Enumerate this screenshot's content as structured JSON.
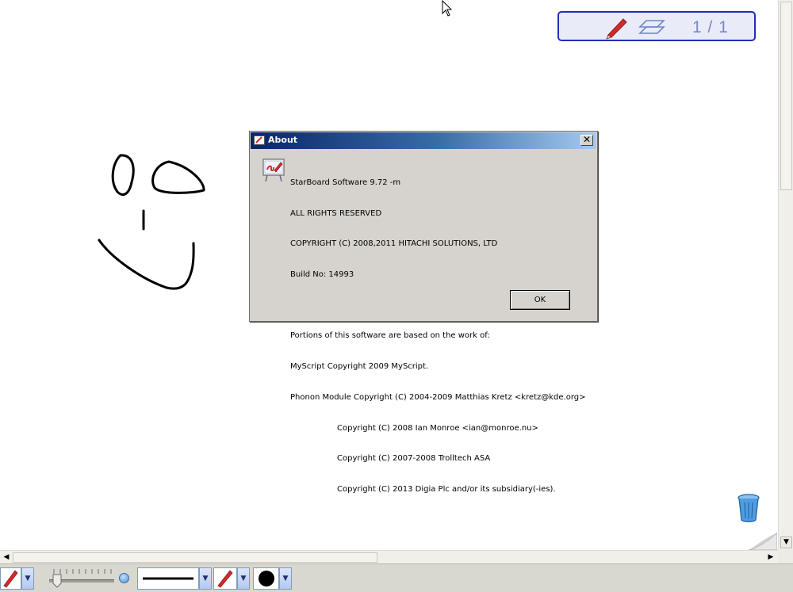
{
  "page_indicator": {
    "current_page": "1 / 1"
  },
  "icons": {
    "pen": "pen-icon",
    "layers": "layers-icon",
    "trash": "trash-icon",
    "cursor": "mouse-cursor-icon",
    "page_curl": "page-curl-icon"
  },
  "about_dialog": {
    "title": "About",
    "close_label": "✕",
    "lines_top": [
      "StarBoard Software 9.72 -m",
      "ALL RIGHTS RESERVED",
      "COPYRIGHT (C) 2008,2011 HITACHI SOLUTIONS, LTD",
      "Build No: 14993"
    ],
    "lines_portions": [
      "Portions of this software are based on the work of:",
      "MyScript Copyright 2009 MyScript.",
      "Phonon Module Copyright (C) 2004-2009 Matthias Kretz <kretz@kde.org>"
    ],
    "lines_indented": [
      "Copyright (C) 2008 Ian Monroe <ian@monroe.nu>",
      "Copyright (C) 2007-2008 Trolltech ASA",
      "Copyright (C) 2013 Digia Plc and/or its subsidiary(-ies)."
    ],
    "ok_label": "OK"
  },
  "colors": {
    "accent_blue": "#1f2fb7",
    "title_bar_start": "#0a246a",
    "title_bar_end": "#a6caf0",
    "dialog_bg": "#d6d3ce",
    "ink": "#000000",
    "pen_red": "#d42a2a"
  }
}
